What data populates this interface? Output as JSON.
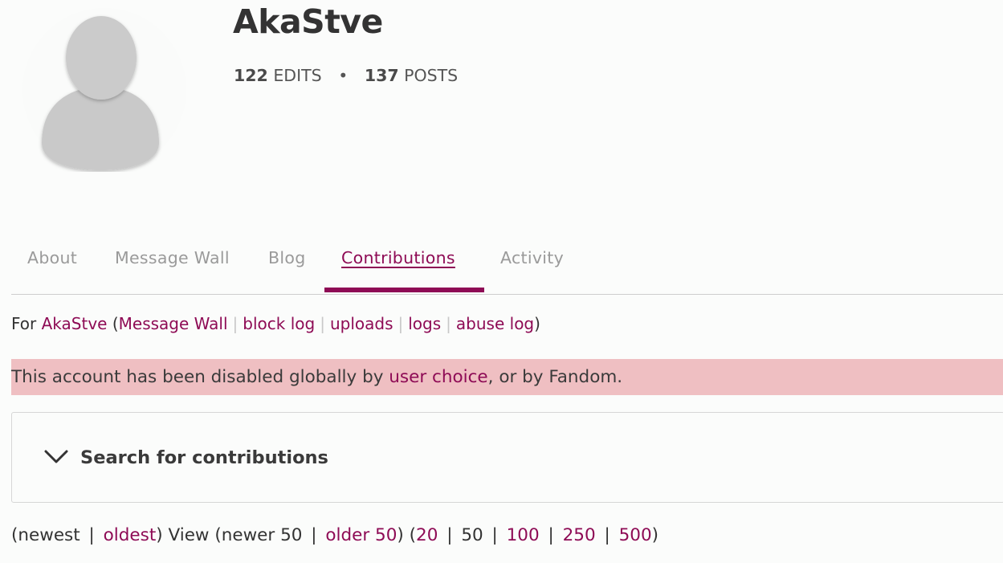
{
  "profile": {
    "username": "AkaStve",
    "edits_count": "122",
    "edits_label": "EDITS",
    "posts_count": "137",
    "posts_label": "POSTS",
    "bullet": "•"
  },
  "tabs": [
    {
      "label": "About"
    },
    {
      "label": "Message Wall"
    },
    {
      "label": "Blog"
    },
    {
      "label": "Contributions",
      "active": true
    },
    {
      "label": "Activity"
    }
  ],
  "for_line": {
    "prefix": "For ",
    "user": "AkaStve",
    "open": " (",
    "message_wall": "Message Wall",
    "block_log": "block log",
    "uploads": "uploads",
    "logs": "logs",
    "abuse_log": "abuse log",
    "close": ")",
    "sep": "|"
  },
  "banner": {
    "before": "This account has been disabled globally by ",
    "link": "user choice",
    "after": ", or by Fandom."
  },
  "search": {
    "title": "Search for contributions"
  },
  "pagination": {
    "open1": "(newest ",
    "oldest": "oldest",
    "mid1": ") View (newer 50 ",
    "older50": "older 50",
    "mid2": ") (",
    "n20": "20",
    "n50": "50",
    "n100": "100",
    "n250": "250",
    "n500": "500",
    "close": ")",
    "sep": "|"
  },
  "colors": {
    "link": "#8e0b55",
    "banner_bg": "#efbfc2",
    "active_tab": "#8e0b55"
  }
}
